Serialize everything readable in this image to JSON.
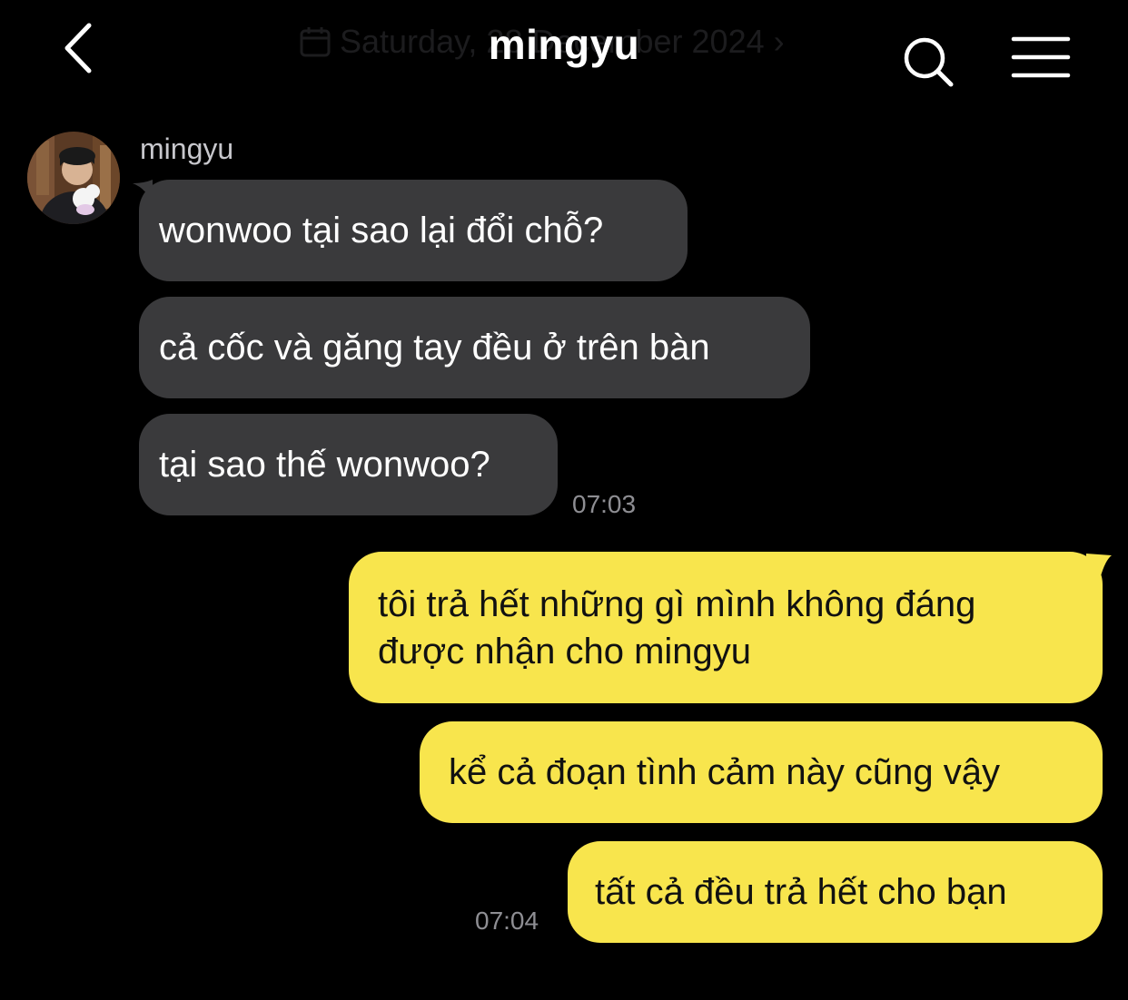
{
  "header": {
    "title": "mingyu",
    "date_label": "Saturday, 28 December 2024 ›"
  },
  "contact": {
    "name": "mingyu"
  },
  "messages_incoming": [
    {
      "text": "wonwoo tại sao lại đổi chỗ?"
    },
    {
      "text": "cả cốc và găng tay đều ở trên bàn"
    },
    {
      "text": "tại sao thế wonwoo?"
    }
  ],
  "incoming_time": "07:03",
  "messages_outgoing": [
    {
      "lines": [
        "tôi trả hết những gì mình không đáng",
        "được nhận cho mingyu"
      ]
    },
    {
      "text": "kể cả đoạn tình cảm này cũng vậy"
    },
    {
      "text": "tất cả đều trả hết cho bạn"
    }
  ],
  "outgoing_time": "07:04",
  "colors": {
    "background": "#000000",
    "incoming_bubble": "#3a3a3c",
    "outgoing_bubble": "#f8e54d",
    "timestamp": "#8e8e93"
  },
  "icons": [
    "back-icon",
    "calendar-icon",
    "search-icon",
    "menu-icon"
  ]
}
